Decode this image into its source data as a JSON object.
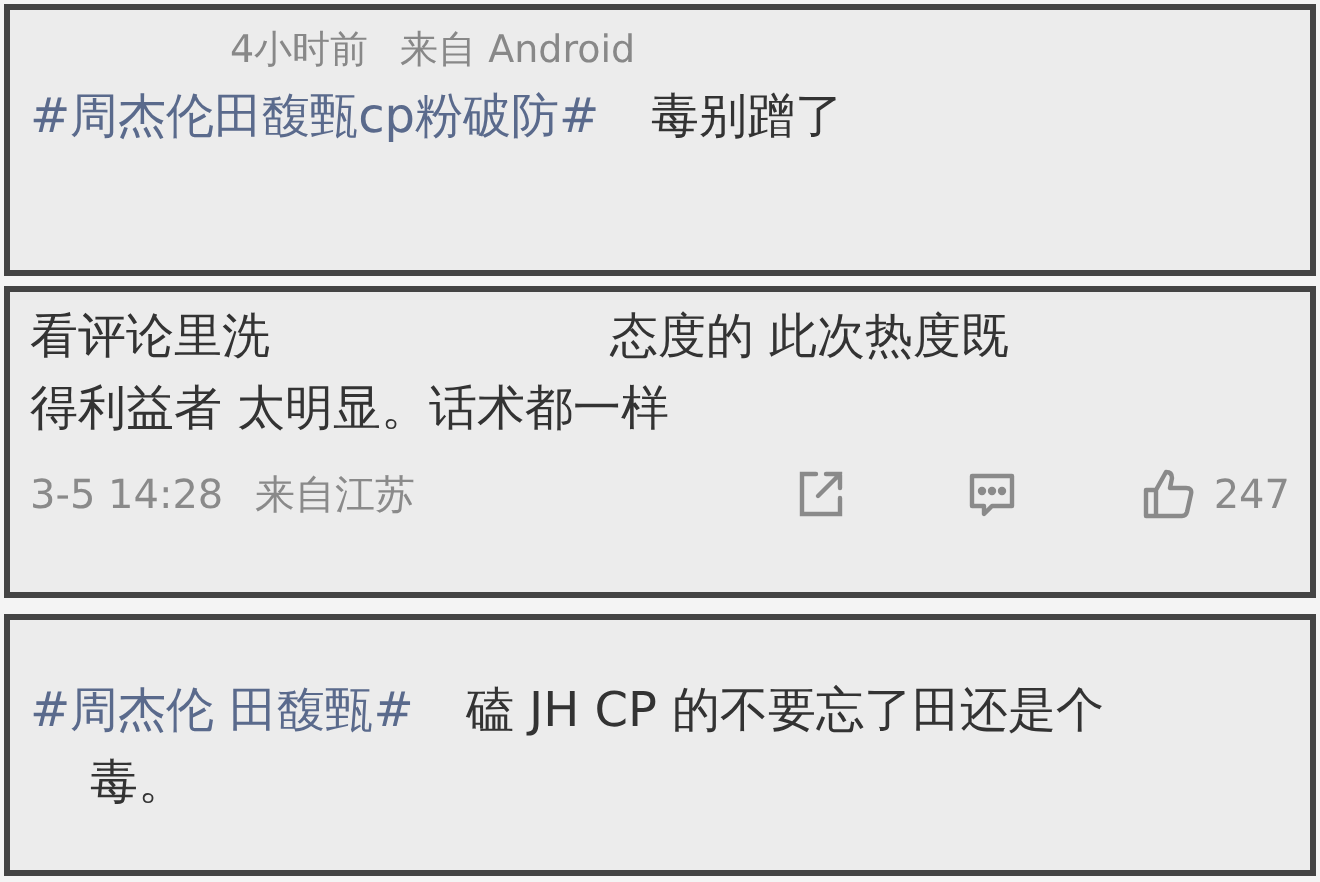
{
  "posts": [
    {
      "meta": [
        "4小时前",
        "来自 Android"
      ],
      "lines": [
        [
          {
            "kind": "hashtag",
            "text": "#周杰伦田馥甄cp粉破防#"
          },
          {
            "kind": "text",
            "text": "毒别蹭了"
          }
        ]
      ]
    },
    {
      "lines": [
        [
          {
            "kind": "text",
            "text": "看评论里洗"
          },
          {
            "kind": "spaced",
            "text": "态度的 此次热度既"
          }
        ],
        [
          {
            "kind": "text",
            "text": "得利益者 太明显。话术都一样"
          }
        ]
      ],
      "footer": {
        "time": "3-5 14:28",
        "source": "来自江苏",
        "likes": "247"
      }
    },
    {
      "lines": [
        [
          {
            "kind": "hashtag",
            "text": "#周杰伦 田馥甄#"
          },
          {
            "kind": "text",
            "text": "磕 JH CP 的不要忘了田还是个"
          }
        ],
        [
          {
            "kind": "indented",
            "text": "毒。"
          }
        ]
      ]
    }
  ]
}
